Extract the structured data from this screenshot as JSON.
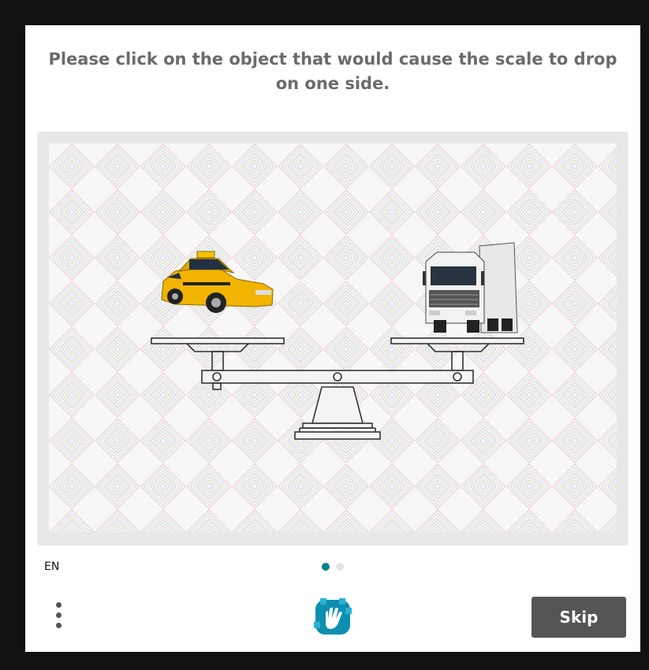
{
  "prompt": {
    "text": "Please click on the object that would cause the scale to drop on one side."
  },
  "challenge": {
    "left_object": "taxi-car",
    "right_object": "truck",
    "scale": "balance-scale"
  },
  "footer": {
    "language": "EN",
    "pagination": {
      "total": 2,
      "current": 1,
      "active_color": "#0a7f8a",
      "inactive_color": "#e4e4e4"
    },
    "menu_icon": "vertical-ellipsis-icon",
    "logo_icon": "hand-logo-icon",
    "skip_label": "Skip"
  },
  "colors": {
    "page_background": "#111111",
    "card_background": "#ffffff",
    "prompt_text": "#6b6b6b",
    "skip_button": "#555555"
  }
}
